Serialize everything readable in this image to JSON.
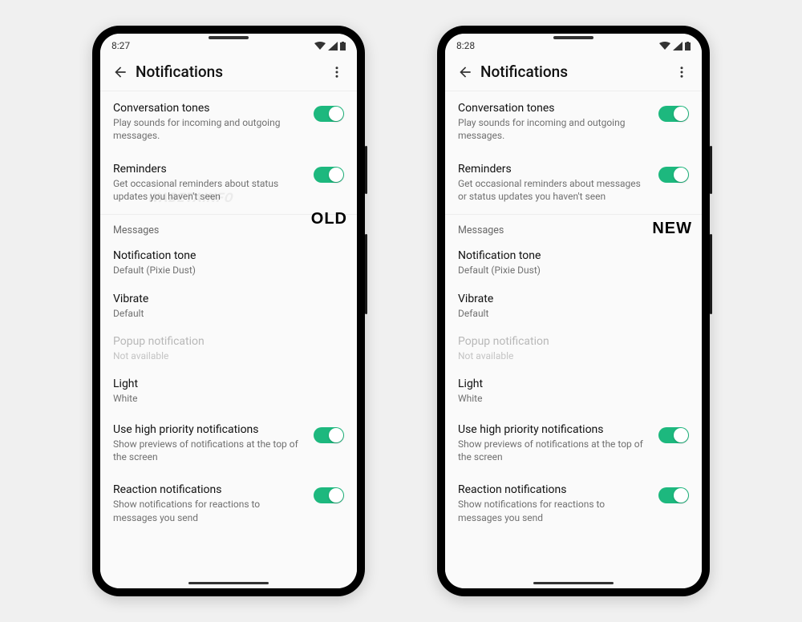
{
  "phones": {
    "old": {
      "time": "8:27",
      "badge": "OLD",
      "watermark": "WABETAINFO",
      "appbar_title": "Notifications",
      "convo_tones": {
        "title": "Conversation tones",
        "sub": "Play sounds for incoming and outgoing messages."
      },
      "reminders": {
        "title": "Reminders",
        "sub": "Get occasional reminders about status updates you haven't seen"
      },
      "section_messages": "Messages",
      "notif_tone": {
        "title": "Notification tone",
        "sub": "Default (Pixie Dust)"
      },
      "vibrate": {
        "title": "Vibrate",
        "sub": "Default"
      },
      "popup": {
        "title": "Popup notification",
        "sub": "Not available"
      },
      "light": {
        "title": "Light",
        "sub": "White"
      },
      "high_priority": {
        "title": "Use high priority notifications",
        "sub": "Show previews of notifications at the top of the screen"
      },
      "reaction": {
        "title": "Reaction notifications",
        "sub": "Show notifications for reactions to messages you send"
      }
    },
    "new": {
      "time": "8:28",
      "badge": "NEW",
      "appbar_title": "Notifications",
      "convo_tones": {
        "title": "Conversation tones",
        "sub": "Play sounds for incoming and outgoing messages."
      },
      "reminders": {
        "title": "Reminders",
        "sub": "Get occasional reminders about messages or status updates you haven't seen"
      },
      "section_messages": "Messages",
      "notif_tone": {
        "title": "Notification tone",
        "sub": "Default (Pixie Dust)"
      },
      "vibrate": {
        "title": "Vibrate",
        "sub": "Default"
      },
      "popup": {
        "title": "Popup notification",
        "sub": "Not available"
      },
      "light": {
        "title": "Light",
        "sub": "White"
      },
      "high_priority": {
        "title": "Use high priority notifications",
        "sub": "Show previews of notifications at the top of the screen"
      },
      "reaction": {
        "title": "Reaction notifications",
        "sub": "Show notifications for reactions to messages you send"
      }
    }
  },
  "colors": {
    "toggle_on": "#1db87e"
  }
}
